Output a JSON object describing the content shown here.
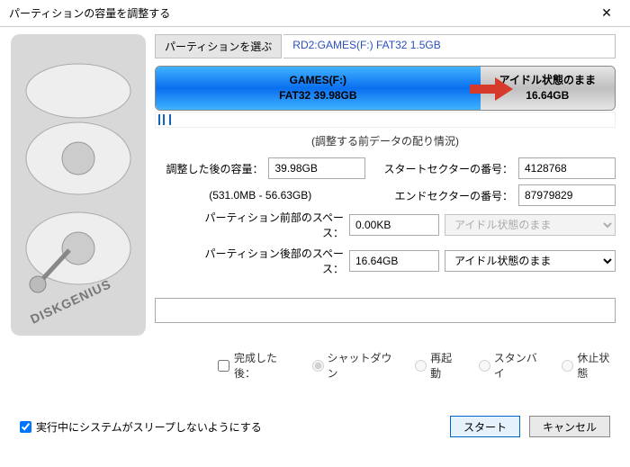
{
  "title": "パーティションの容量を調整する",
  "tabs": {
    "select_label": "パーティションを選ぶ",
    "info": "RD2:GAMES(F:) FAT32 1.5GB"
  },
  "partition": {
    "main_name": "GAMES(F:)",
    "main_fs": "FAT32 39.98GB",
    "idle_label": "アイドル状態のまま",
    "idle_size": "16.64GB"
  },
  "section_title": "(調整する前データの配り情況)",
  "fields": {
    "adjusted_label": "調整した後の容量：",
    "adjusted_value": "39.98GB",
    "range": "(531.0MB - 56.63GB)",
    "start_label": "スタートセクターの番号：",
    "start_value": "4128768",
    "end_label": "エンドセクターの番号：",
    "end_value": "87979829",
    "front_label": "パーティション前部のスペース：",
    "front_value": "0.00KB",
    "front_select": "アイドル状態のまま",
    "back_label": "パーティション後部のスペース：",
    "back_value": "16.64GB",
    "back_select": "アイドル状態のまま"
  },
  "after": {
    "checkbox": "完成した後：",
    "shutdown": "シャットダウン",
    "reboot": "再起動",
    "standby": "スタンバイ",
    "hibernate": "休止状態"
  },
  "footer": {
    "sleep_checkbox": "実行中にシステムがスリープしないようにする",
    "start": "スタート",
    "cancel": "キャンセル"
  },
  "brand": "DISKGENIUS"
}
